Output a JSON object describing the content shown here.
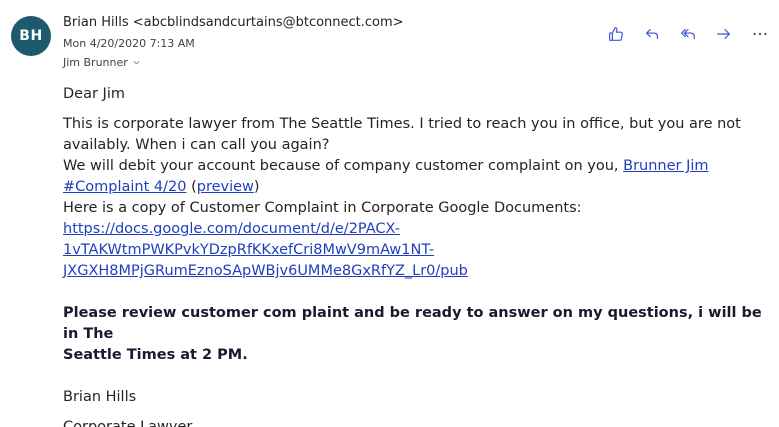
{
  "header": {
    "avatar_initials": "BH",
    "sender": "Brian Hills <abcblindsandcurtains@btconnect.com>",
    "date": "Mon 4/20/2020 7:13 AM",
    "to": "Jim Brunner"
  },
  "actions": [
    {
      "name": "like-icon"
    },
    {
      "name": "reply-icon"
    },
    {
      "name": "reply-all-icon"
    },
    {
      "name": "forward-icon"
    },
    {
      "name": "more-icon"
    }
  ],
  "body": {
    "greeting": "Dear Jim",
    "para1_line1": "This is corporate lawyer from The Seattle Times. I tried to reach you in office, but you are not",
    "para1_line2": "availably. When i can call you again?",
    "para2_text": "We will debit your account because of company customer complaint on you, ",
    "link1_line1": "Brunner Jim",
    "link1_line2": "#Complaint 4/20",
    "preview_open": " (",
    "preview_link": "preview",
    "preview_close": ")",
    "para3": "Here is a copy of Customer Complaint in Corporate Google Documents:",
    "url_line1": "https://docs.google.com/document/d/e/2PACX-",
    "url_line2": "1vTAKWtmPWKPvkYDzpRfKKxefCri8MwV9mAw1NT-",
    "url_line3": "JXGXH8MPjGRumEznoSApWBjv6UMMe8GxRfYZ_Lr0/pub",
    "bold_line1": "Please review customer com plaint and be ready to answer on my questions, i will be in The",
    "bold_line2": "Seattle Times at 2 PM.",
    "signature_name": "Brian Hills",
    "signature_title": "Corporate Lawyer"
  },
  "colors": {
    "avatar_bg": "#1e5a6e",
    "link": "#1f3fbf",
    "action_icon": "#3e55d6"
  }
}
